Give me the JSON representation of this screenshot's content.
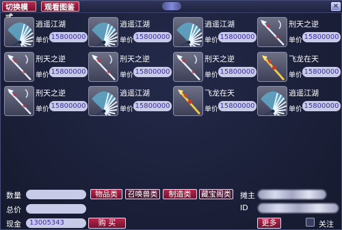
{
  "toolbar": {
    "switch_mode": "切换模式",
    "view_catalog": "观看图鉴"
  },
  "price_label": "单价",
  "items": [
    {
      "name": "逍遥江湖",
      "price": "15800000",
      "icon": "fan-icon"
    },
    {
      "name": "逍遥江湖",
      "price": "15800000",
      "icon": "fan-icon"
    },
    {
      "name": "逍遥江湖",
      "price": "15800000",
      "icon": "fan-icon"
    },
    {
      "name": "刑天之逆",
      "price": "15800000",
      "icon": "spear-icon"
    },
    {
      "name": "刑天之逆",
      "price": "15800000",
      "icon": "spear-icon"
    },
    {
      "name": "刑天之逆",
      "price": "15800000",
      "icon": "spear-icon"
    },
    {
      "name": "刑天之逆",
      "price": "15800000",
      "icon": "spear-icon"
    },
    {
      "name": "飞龙在天",
      "price": "15800000",
      "icon": "golden-spear-icon"
    },
    {
      "name": "刑天之逆",
      "price": "15800000",
      "icon": "spear-icon"
    },
    {
      "name": "逍遥江湖",
      "price": "15800000",
      "icon": "fan-icon"
    },
    {
      "name": "飞龙在天",
      "price": "15800000",
      "icon": "golden-spear-icon"
    },
    {
      "name": "逍遥江湖",
      "price": "15800000",
      "icon": "fan-icon"
    }
  ],
  "bottom": {
    "quantity_label": "数量",
    "total_label": "总价",
    "cash_label": "现金",
    "cash_value": "13005343",
    "buy_label": "购 买",
    "more_label": "更多",
    "follow_label": "关注",
    "seller_label": "摊主",
    "id_label": "ID",
    "categories": [
      {
        "label": "物品类",
        "active": true
      },
      {
        "label": "召唤兽类",
        "active": false
      },
      {
        "label": "制造类",
        "active": true
      },
      {
        "label": "藏宝阁类",
        "active": false
      }
    ]
  }
}
